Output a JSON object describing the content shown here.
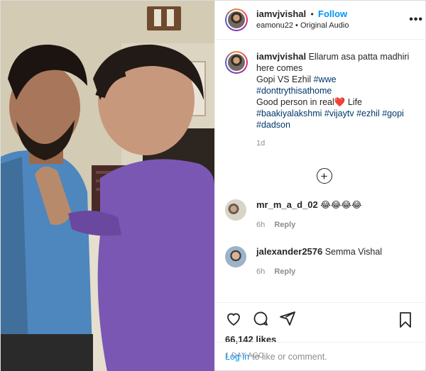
{
  "header": {
    "username": "iamvjvishal",
    "separator": "•",
    "follow_label": "Follow",
    "audio": "eamonu22 • Original Audio",
    "more_label": "•••"
  },
  "caption": {
    "username": "iamvjvishal",
    "line1": "Ellarum asa patta madhiri here comes",
    "line2": "Gopi VS Ezhil",
    "tag_wwe": "#wwe",
    "tag_dont": "#donttrythisathome",
    "line3a": "Good person in real",
    "heart": "❤️",
    "line3b": "Life",
    "tag_baakiya": "#baakiyalakshmi",
    "tag_vijay": "#vijaytv",
    "tag_ezhil": "#ezhil",
    "tag_gopi": "#gopi",
    "tag_dadson": "#dadson",
    "age": "1d"
  },
  "load_more": "+",
  "comments": [
    {
      "username": "mr_m_a_d_02",
      "text": "😂😂😂😂",
      "age": "6h",
      "reply": "Reply"
    },
    {
      "username": "jalexander2576",
      "text": "Semma Vishal",
      "age": "6h",
      "reply": "Reply"
    }
  ],
  "stats": {
    "likes": "66,142 likes",
    "posted": "1 DAY AGO"
  },
  "footer": {
    "login_link": "Log in",
    "login_text": "to like or comment."
  },
  "icons": {
    "like": "heart-outline-icon",
    "comment": "comment-bubble-icon",
    "share": "paper-plane-icon",
    "save": "bookmark-icon"
  }
}
